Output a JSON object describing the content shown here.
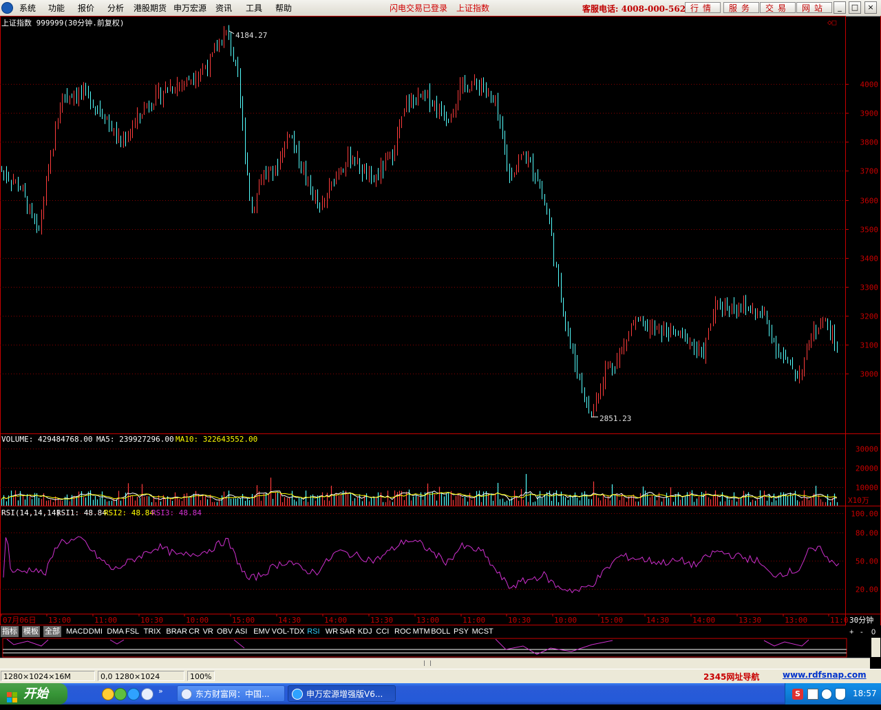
{
  "menu": {
    "items": [
      "系统",
      "功能",
      "报价",
      "分析",
      "港股期货",
      "申万宏源",
      "资讯",
      "工具",
      "帮助"
    ],
    "status_login": "闪电交易已登录",
    "status_index": "上证指数",
    "hotline": "客服电话: 4008-000-562",
    "buttons": [
      "行情",
      "服务",
      "交易",
      "网站"
    ],
    "win_controls": [
      "_",
      "□",
      "×"
    ]
  },
  "chart": {
    "title": "上证指数 999999(30分钟.前复权)",
    "corner_marks": "◇□",
    "high_label": "4184.27",
    "low_label": "2851.23",
    "price_ticks": [
      "4000",
      "3900",
      "3800",
      "3700",
      "3600",
      "3500",
      "3400",
      "3300",
      "3200",
      "3100",
      "3000"
    ],
    "volume": {
      "label": "VOLUME: 429484768.00",
      "ma5": "MA5: 239927296.00",
      "ma10": "MA10: 322643552.00",
      "ticks": [
        "30000",
        "20000",
        "10000"
      ],
      "unit": "X10万"
    },
    "rsi": {
      "label": "RSI(14,14,14)",
      "rsi1": "RSI1: 48.84",
      "rsi2": "RSI2: 48.84",
      "rsi3": "RSI3: 48.84",
      "ticks": [
        "100.00",
        "80.00",
        "50.00",
        "20.00"
      ]
    },
    "time_labels": [
      "07月06日",
      "13:00",
      "11:00",
      "10:30",
      "10:00",
      "15:00",
      "14:30",
      "14:00",
      "13:30",
      "13:00",
      "11:00",
      "10:30",
      "10:00",
      "15:00",
      "14:30",
      "14:00",
      "13:30",
      "13:00",
      "11:0"
    ],
    "period": "30分钟",
    "colors": {
      "up": "#ff3c3c",
      "down": "#54ffff",
      "rsi": "#d030d0",
      "grid": "#8c0000",
      "axis": "#c80000",
      "ma5": "#ffffff",
      "ma10": "#ffff00"
    }
  },
  "tabs": {
    "items": [
      "指标",
      "模板",
      "全部",
      "MACD",
      "DMI",
      "DMA",
      "FSL",
      "TRIX",
      "BRAR",
      "CR",
      "VR",
      "OBV",
      "ASI",
      "EMV",
      "VOL-TDX",
      "RSI",
      "WR",
      "SAR",
      "KDJ",
      "CCI",
      "ROC",
      "MTM",
      "BOLL",
      "PSY",
      "MCST"
    ],
    "active": "RSI",
    "controls": [
      "+",
      "-",
      "0"
    ]
  },
  "statusbar": {
    "resolution": "1280×1024×16M",
    "cursor": "0,0 1280×1024",
    "zoom": "100%",
    "ad1": "2345网址导航",
    "ad2": "www.rdfsnap.com"
  },
  "taskbar": {
    "start": "开始",
    "items": [
      "东方财富网：中国...",
      "申万宏源增强版V6..."
    ],
    "clock": "18:57"
  }
}
